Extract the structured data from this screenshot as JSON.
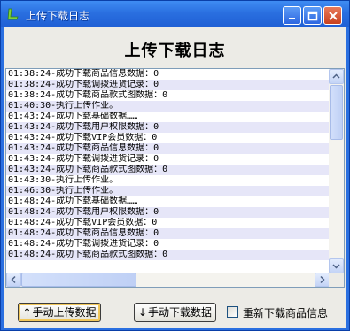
{
  "window": {
    "title": "上传下载日志"
  },
  "heading": "上传下载日志",
  "log_lines": [
    "01:38:24-成功下载商品信息数据：0",
    "01:38:24-成功下载调拨进货记录：0",
    "01:38:24-成功下载商品款式图数据：0",
    "01:40:30-执行上传作业。",
    "01:43:24-成功下载基础数据……",
    "01:43:24-成功下载用户权限数据：0",
    "01:43:24-成功下载VIP会员数据：0",
    "01:43:24-成功下载商品信息数据：0",
    "01:43:24-成功下载调拨进货记录：0",
    "01:43:24-成功下载商品款式图数据：0",
    "01:43:30-执行上传作业。",
    "01:46:30-执行上传作业。",
    "01:48:24-成功下载基础数据……",
    "01:48:24-成功下载用户权限数据：0",
    "01:48:24-成功下载VIP会员数据：0",
    "01:48:24-成功下载商品信息数据：0",
    "01:48:24-成功下载调拨进货记录：0",
    "01:48:24-成功下载商品款式图数据：0"
  ],
  "buttons": {
    "upload": "手动上传数据",
    "download": "手动下载数据"
  },
  "checkbox": {
    "label": "重新下载商品信息",
    "checked": false
  },
  "icons": {
    "app": "app-logo-icon",
    "minimize": "minimize-icon",
    "maximize": "maximize-icon",
    "close": "close-icon"
  }
}
